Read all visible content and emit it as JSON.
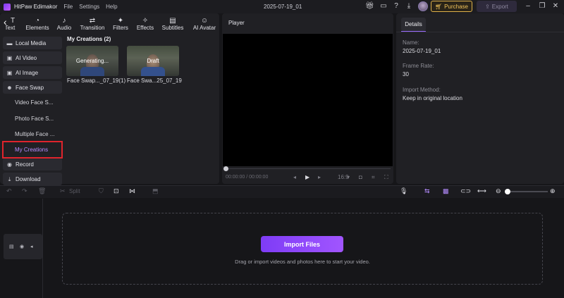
{
  "app": {
    "name": "HitPaw Edimakor",
    "menu": [
      "File",
      "Settings",
      "Help"
    ],
    "project_title": "2025-07-19_01",
    "purchase_label": "Purchase",
    "export_label": "Export"
  },
  "toolbar": {
    "tools": [
      {
        "label": "Text",
        "icon": "text-icon"
      },
      {
        "label": "Elements",
        "icon": "elements-icon"
      },
      {
        "label": "Audio",
        "icon": "music-note-icon"
      },
      {
        "label": "Transition",
        "icon": "transition-icon"
      },
      {
        "label": "Filters",
        "icon": "sparkle-icon"
      },
      {
        "label": "Effects",
        "icon": "magic-wand-icon"
      },
      {
        "label": "Subtitles",
        "icon": "subtitles-icon"
      },
      {
        "label": "AI Avatar",
        "icon": "avatar-icon"
      }
    ]
  },
  "sidebar": {
    "items": [
      {
        "label": "Local Media"
      },
      {
        "label": "AI Video"
      },
      {
        "label": "AI Image"
      },
      {
        "label": "Face Swap"
      }
    ],
    "sub_items": [
      {
        "label": "Video Face S..."
      },
      {
        "label": "Photo Face S..."
      },
      {
        "label": "Multiple Face ..."
      },
      {
        "label": "My Creations"
      }
    ],
    "bottom_items": [
      {
        "label": "Record"
      },
      {
        "label": "Download"
      }
    ]
  },
  "creations": {
    "title": "My Creations (2)",
    "items": [
      {
        "overlay": "Generating...",
        "label": "Face Swap..._07_19(1)"
      },
      {
        "overlay": "Draft",
        "label": "Face Swa...25_07_19"
      }
    ]
  },
  "player": {
    "title": "Player",
    "timecode": "00:00:00 / 00:00:00",
    "aspect_ratio": "16:9"
  },
  "details": {
    "tab_label": "Details",
    "fields": [
      {
        "label": "Name:",
        "value": "2025-07-19_01"
      },
      {
        "label": "Frame Rate:",
        "value": "30"
      },
      {
        "label": "Import Method:",
        "value": "Keep in original location"
      }
    ]
  },
  "timeline": {
    "split_label": "Split",
    "import_label": "Import Files",
    "drop_hint": "Drag or import videos and photos here to start your video."
  },
  "colors": {
    "accent": "#a155ff",
    "purchase": "#f0c35a",
    "highlight_box": "#e0242c"
  }
}
